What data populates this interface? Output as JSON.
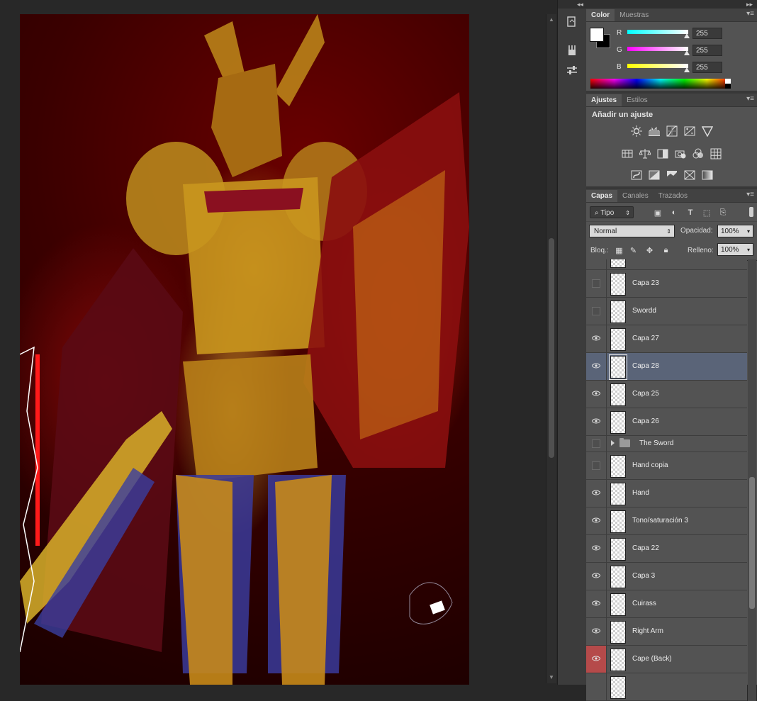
{
  "color_panel": {
    "tabs": [
      {
        "label": "Color",
        "active": true
      },
      {
        "label": "Muestras",
        "active": false
      }
    ],
    "channels": [
      {
        "label": "R",
        "value": "255",
        "color": "#00e5ff"
      },
      {
        "label": "G",
        "value": "255",
        "color": "#ff00ff"
      },
      {
        "label": "B",
        "value": "255",
        "color": "#ffff00"
      }
    ],
    "foreground": "#ffffff",
    "background": "#000000"
  },
  "adjust_panel": {
    "tabs": [
      {
        "label": "Ajustes",
        "active": true
      },
      {
        "label": "Estilos",
        "active": false
      }
    ],
    "title": "Añadir un ajuste",
    "icons": [
      [
        "brightness-icon",
        "levels-icon",
        "curves-icon",
        "exposure-icon",
        "vibrance-icon"
      ],
      [
        "hue-saturation-icon",
        "color-balance-icon",
        "black-white-icon",
        "photo-filter-icon",
        "channel-mixer-icon",
        "color-lookup-icon"
      ],
      [
        "invert-icon",
        "posterize-icon",
        "threshold-icon",
        "selective-color-icon",
        "gradient-map-icon"
      ]
    ]
  },
  "layers_panel": {
    "tabs": [
      {
        "label": "Capas",
        "active": true
      },
      {
        "label": "Canales",
        "active": false
      },
      {
        "label": "Trazados",
        "active": false
      }
    ],
    "kind_filter": "Tipo",
    "blend_mode": "Normal",
    "opacity_label": "Opacidad:",
    "opacity": "100%",
    "lock_label": "Bloq.:",
    "fill_label": "Relleno:",
    "fill": "100%",
    "layers": [
      {
        "name": "Capa 23",
        "visible": false,
        "selected": false,
        "type": "layer"
      },
      {
        "name": "Swordd",
        "visible": false,
        "selected": false,
        "type": "layer"
      },
      {
        "name": "Capa 27",
        "visible": true,
        "selected": false,
        "type": "layer"
      },
      {
        "name": "Capa 28",
        "visible": true,
        "selected": true,
        "type": "layer"
      },
      {
        "name": "Capa 25",
        "visible": true,
        "selected": false,
        "type": "layer"
      },
      {
        "name": "Capa 26",
        "visible": true,
        "selected": false,
        "type": "layer"
      },
      {
        "name": "The Sword",
        "visible": false,
        "selected": false,
        "type": "group"
      },
      {
        "name": "Hand copia",
        "visible": false,
        "selected": false,
        "type": "layer"
      },
      {
        "name": "Hand",
        "visible": true,
        "selected": false,
        "type": "layer"
      },
      {
        "name": "Tono/saturación 3",
        "visible": true,
        "selected": false,
        "type": "layer"
      },
      {
        "name": "Capa 22",
        "visible": true,
        "selected": false,
        "type": "layer"
      },
      {
        "name": "Capa 3",
        "visible": true,
        "selected": false,
        "type": "layer"
      },
      {
        "name": "Cuirass",
        "visible": true,
        "selected": false,
        "type": "layer"
      },
      {
        "name": "Right Arm",
        "visible": true,
        "selected": false,
        "type": "layer"
      },
      {
        "name": "Cape (Back)",
        "visible": true,
        "selected": false,
        "type": "layer",
        "highlight": "#b54a4a"
      }
    ]
  },
  "icon_column": {
    "tools": [
      "history-icon",
      "brush-presets-icon",
      "tool-presets-icon"
    ]
  }
}
